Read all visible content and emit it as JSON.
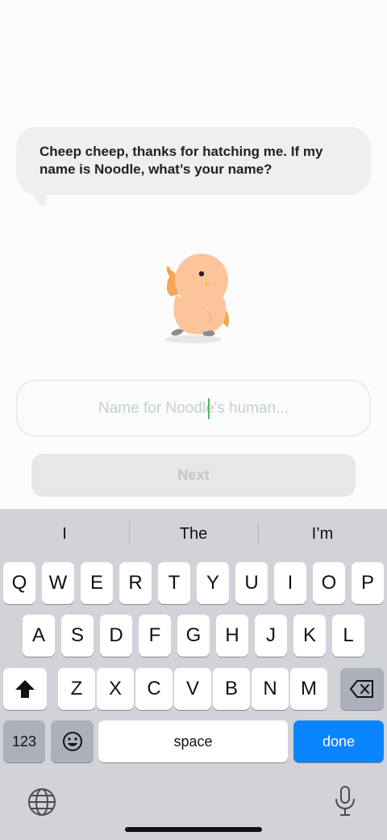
{
  "chat": {
    "message": "Cheep cheep, thanks for hatching me. If my name is Noodle, what’s your name?"
  },
  "mascot": {
    "name_icon": "chick-mascot-icon"
  },
  "form": {
    "name_value": "",
    "name_placeholder": "Name for Noodle's human...",
    "next_label": "Next"
  },
  "keyboard": {
    "suggestions": [
      "I",
      "The",
      "I’m"
    ],
    "row1": [
      "Q",
      "W",
      "E",
      "R",
      "T",
      "Y",
      "U",
      "I",
      "O",
      "P"
    ],
    "row2": [
      "A",
      "S",
      "D",
      "F",
      "G",
      "H",
      "J",
      "K",
      "L"
    ],
    "row3": [
      "Z",
      "X",
      "C",
      "V",
      "B",
      "N",
      "M"
    ],
    "numbers_label": "123",
    "space_label": "space",
    "done_label": "done",
    "accent_color": "#0a84ff",
    "icons": [
      "shift-icon",
      "delete-icon",
      "emoji-icon",
      "globe-icon",
      "microphone-icon"
    ]
  }
}
